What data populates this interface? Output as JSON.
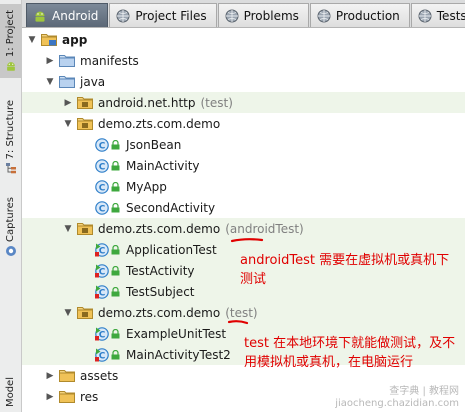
{
  "side_tabs": [
    {
      "label": "1: Project",
      "icon": "android-icon"
    },
    {
      "label": "7: Structure",
      "icon": "structure-icon"
    },
    {
      "label": "Captures",
      "icon": "captures-icon"
    },
    {
      "label": "Model",
      "icon": ""
    }
  ],
  "tabs": [
    {
      "label": "Android",
      "icon": "android-icon"
    },
    {
      "label": "Project Files",
      "icon": "globe-icon"
    },
    {
      "label": "Problems",
      "icon": "globe-icon"
    },
    {
      "label": "Production",
      "icon": "globe-icon"
    },
    {
      "label": "Tests",
      "icon": "globe-icon"
    }
  ],
  "tree": {
    "app": "app",
    "manifests": "manifests",
    "java": "java",
    "pkg_http": "android.net.http",
    "pkg_http_tag": "(test)",
    "pkg_main": "demo.zts.com.demo",
    "classes_main": [
      "JsonBean",
      "MainActivity",
      "MyApp",
      "SecondActivity"
    ],
    "pkg_android_test": "demo.zts.com.demo",
    "pkg_android_test_tag": "(androidTest)",
    "classes_android_test": [
      "ApplicationTest",
      "TestActivity",
      "TestSubject"
    ],
    "pkg_unit_test": "demo.zts.com.demo",
    "pkg_unit_test_tag": "(test)",
    "classes_unit_test": [
      "ExampleUnitTest",
      "MainActivityTest2"
    ],
    "assets": "assets",
    "res": "res"
  },
  "annotations": {
    "android_test_note": "androidTest 需要在虚拟机或真机下测试",
    "unit_test_note": "test 在本地环境下就能做测试，及不用模拟机或真机，在电脑运行"
  },
  "watermark": {
    "line1": "查字典 | 教程网",
    "line2": "jiaocheng.chazidian.com"
  },
  "colors": {
    "annotation": "#e00000",
    "highlight_row": "#eef5e9",
    "active_tab": "#5c6877",
    "folder": "#e3b447",
    "class_icon": "#2f7fc9"
  }
}
